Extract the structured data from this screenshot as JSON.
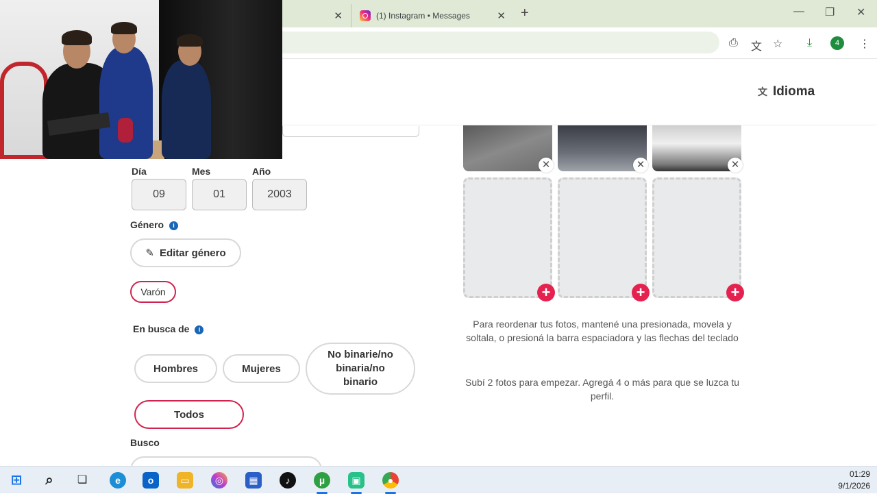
{
  "browser": {
    "active_tab_title": "(1) Instagram • Messages",
    "download_badge": "4",
    "icons": [
      "close-icon",
      "new-tab-icon",
      "minimize-icon",
      "restore-icon",
      "window-close-icon",
      "install-icon",
      "translate-icon",
      "star-icon",
      "download-icon",
      "menu-icon"
    ]
  },
  "header": {
    "language_label": "Idioma"
  },
  "birthdate": {
    "day_label": "Día",
    "month_label": "Mes",
    "year_label": "Año",
    "day": "09",
    "month": "01",
    "year": "2003"
  },
  "gender": {
    "label": "Género",
    "edit_button": "Editar género",
    "selected": "Varón"
  },
  "looking_for": {
    "label": "En busca de",
    "options": [
      "Hombres",
      "Mujeres",
      "No binarie/no binaria/no binario",
      "Todos"
    ],
    "selected": "Todos"
  },
  "seeking_label": "Busco",
  "photos": {
    "help_text": "Para reordenar tus fotos, mantené una presionada, movela y soltala, o presioná la barra espaciadora y las flechas del teclado",
    "upload_text": "Subí 2 fotos para empezar. Agregá 4 o más para que se luzca tu perfil."
  },
  "taskbar": {
    "time": "01:29",
    "date": "9/1/2026"
  },
  "colors": {
    "accent": "#e5224f",
    "selected_border": "#d0244f",
    "info": "#1866b8"
  }
}
